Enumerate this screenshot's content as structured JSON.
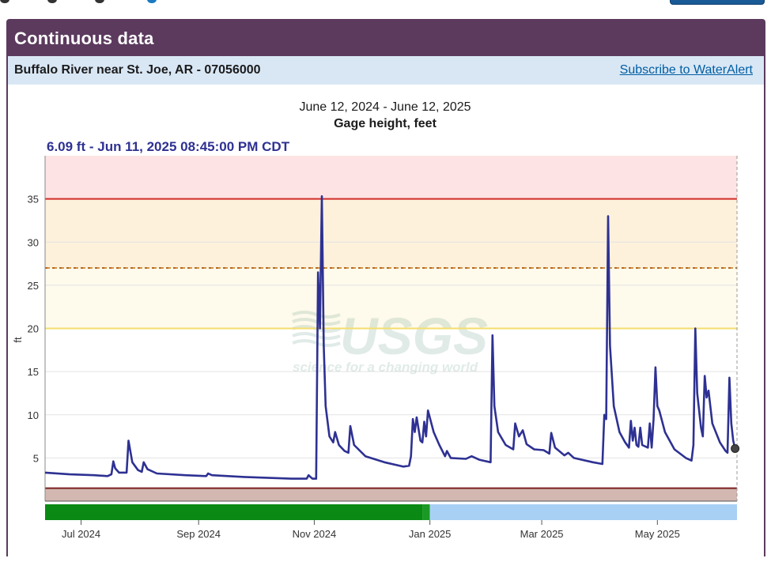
{
  "page": {
    "title": "Continuous data",
    "site_name": "Buffalo River near St. Joe, AR - 07056000",
    "subscribe_label": "Subscribe to WaterAlert"
  },
  "chart_data": {
    "type": "line",
    "date_range": "June 12, 2024 - June 12, 2025",
    "title": "Gage height, feet",
    "current_reading": "6.09 ft - Jun 11, 2025 08:45:00 PM CDT",
    "ylabel": "ft",
    "ylim": [
      0,
      40
    ],
    "yticks": [
      5,
      10,
      15,
      20,
      25,
      30,
      35
    ],
    "xlim": [
      "2024-06-12",
      "2025-06-12"
    ],
    "xticks": [
      {
        "date": "2024-07-01",
        "label": "Jul 2024"
      },
      {
        "date": "2024-09-01",
        "label": "Sep 2024"
      },
      {
        "date": "2024-11-01",
        "label": "Nov 2024"
      },
      {
        "date": "2025-01-01",
        "label": "Jan 2025"
      },
      {
        "date": "2025-03-01",
        "label": "Mar 2025"
      },
      {
        "date": "2025-05-01",
        "label": "May 2025"
      }
    ],
    "thresholds": [
      {
        "value": 35,
        "color": "#d22b2b",
        "style": "solid",
        "band_above": "#fde3e3"
      },
      {
        "value": 27,
        "color": "#b5651d",
        "style": "dashed",
        "band_above": "#fdf1dc"
      },
      {
        "value": 20,
        "color": "#f4de6b",
        "style": "solid",
        "band_above": "#fefaec"
      },
      {
        "value": 1.5,
        "color": "#7a1f1f",
        "style": "solid",
        "band_below": "#d3b8b2"
      }
    ],
    "grid": true,
    "watermark": {
      "mark": "USGS",
      "tagline": "science for a changing world"
    },
    "line_color": "#2e3192",
    "series": [
      {
        "points": [
          [
            "2024-06-12",
            3.3
          ],
          [
            "2024-06-25",
            3.1
          ],
          [
            "2024-07-08",
            3.0
          ],
          [
            "2024-07-15",
            2.9
          ],
          [
            "2024-07-17",
            3.1
          ],
          [
            "2024-07-18",
            4.6
          ],
          [
            "2024-07-19",
            3.8
          ],
          [
            "2024-07-21",
            3.3
          ],
          [
            "2024-07-25",
            3.3
          ],
          [
            "2024-07-26",
            7.0
          ],
          [
            "2024-07-28",
            4.5
          ],
          [
            "2024-07-31",
            3.6
          ],
          [
            "2024-08-02",
            3.4
          ],
          [
            "2024-08-03",
            4.5
          ],
          [
            "2024-08-05",
            3.7
          ],
          [
            "2024-08-10",
            3.2
          ],
          [
            "2024-08-25",
            3.0
          ],
          [
            "2024-09-05",
            2.9
          ],
          [
            "2024-09-06",
            3.2
          ],
          [
            "2024-09-08",
            3.0
          ],
          [
            "2024-09-25",
            2.8
          ],
          [
            "2024-10-20",
            2.6
          ],
          [
            "2024-10-28",
            2.6
          ],
          [
            "2024-10-29",
            3.0
          ],
          [
            "2024-10-31",
            2.6
          ],
          [
            "2024-11-02",
            2.6
          ],
          [
            "2024-11-03",
            26.5
          ],
          [
            "2024-11-04",
            20.0
          ],
          [
            "2024-11-05",
            35.3
          ],
          [
            "2024-11-06",
            18.0
          ],
          [
            "2024-11-07",
            11.0
          ],
          [
            "2024-11-09",
            7.5
          ],
          [
            "2024-11-11",
            6.8
          ],
          [
            "2024-11-12",
            8.0
          ],
          [
            "2024-11-14",
            6.5
          ],
          [
            "2024-11-17",
            5.8
          ],
          [
            "2024-11-19",
            5.6
          ],
          [
            "2024-11-20",
            8.7
          ],
          [
            "2024-11-22",
            6.5
          ],
          [
            "2024-11-28",
            5.2
          ],
          [
            "2024-12-08",
            4.5
          ],
          [
            "2024-12-18",
            4.0
          ],
          [
            "2024-12-21",
            4.1
          ],
          [
            "2024-12-22",
            5.2
          ],
          [
            "2024-12-23",
            9.5
          ],
          [
            "2024-12-24",
            8.0
          ],
          [
            "2024-12-25",
            9.7
          ],
          [
            "2024-12-27",
            7.0
          ],
          [
            "2024-12-28",
            6.8
          ],
          [
            "2024-12-29",
            9.2
          ],
          [
            "2024-12-30",
            7.5
          ],
          [
            "2024-12-31",
            10.5
          ],
          [
            "2025-01-03",
            8.0
          ],
          [
            "2025-01-06",
            6.5
          ],
          [
            "2025-01-09",
            5.2
          ],
          [
            "2025-01-10",
            5.8
          ],
          [
            "2025-01-12",
            5.0
          ],
          [
            "2025-01-20",
            4.9
          ],
          [
            "2025-01-23",
            5.2
          ],
          [
            "2025-01-27",
            4.8
          ],
          [
            "2025-02-02",
            4.5
          ],
          [
            "2025-02-03",
            19.2
          ],
          [
            "2025-02-04",
            11.0
          ],
          [
            "2025-02-06",
            8.0
          ],
          [
            "2025-02-10",
            6.5
          ],
          [
            "2025-02-14",
            6.0
          ],
          [
            "2025-02-15",
            9.0
          ],
          [
            "2025-02-17",
            7.5
          ],
          [
            "2025-02-19",
            8.2
          ],
          [
            "2025-02-21",
            6.6
          ],
          [
            "2025-02-25",
            6.0
          ],
          [
            "2025-03-02",
            5.9
          ],
          [
            "2025-03-05",
            5.5
          ],
          [
            "2025-03-06",
            7.9
          ],
          [
            "2025-03-08",
            6.2
          ],
          [
            "2025-03-13",
            5.3
          ],
          [
            "2025-03-15",
            5.6
          ],
          [
            "2025-03-18",
            5.0
          ],
          [
            "2025-03-28",
            4.5
          ],
          [
            "2025-04-02",
            4.3
          ],
          [
            "2025-04-03",
            10.0
          ],
          [
            "2025-04-04",
            9.5
          ],
          [
            "2025-04-05",
            33.0
          ],
          [
            "2025-04-06",
            18.0
          ],
          [
            "2025-04-08",
            11.0
          ],
          [
            "2025-04-11",
            8.0
          ],
          [
            "2025-04-14",
            6.8
          ],
          [
            "2025-04-16",
            6.2
          ],
          [
            "2025-04-17",
            9.3
          ],
          [
            "2025-04-18",
            7.0
          ],
          [
            "2025-04-19",
            8.5
          ],
          [
            "2025-04-20",
            6.5
          ],
          [
            "2025-04-21",
            6.3
          ],
          [
            "2025-04-22",
            8.5
          ],
          [
            "2025-04-23",
            6.5
          ],
          [
            "2025-04-26",
            6.2
          ],
          [
            "2025-04-27",
            9.0
          ],
          [
            "2025-04-28",
            6.2
          ],
          [
            "2025-04-29",
            9.5
          ],
          [
            "2025-04-30",
            15.5
          ],
          [
            "2025-05-01",
            11.0
          ],
          [
            "2025-05-02",
            10.5
          ],
          [
            "2025-05-05",
            8.0
          ],
          [
            "2025-05-10",
            6.0
          ],
          [
            "2025-05-16",
            5.0
          ],
          [
            "2025-05-19",
            4.7
          ],
          [
            "2025-05-20",
            6.5
          ],
          [
            "2025-05-21",
            20.0
          ],
          [
            "2025-05-22",
            12.5
          ],
          [
            "2025-05-24",
            8.5
          ],
          [
            "2025-05-25",
            7.5
          ],
          [
            "2025-05-26",
            14.5
          ],
          [
            "2025-05-27",
            12.0
          ],
          [
            "2025-05-28",
            12.8
          ],
          [
            "2025-05-30",
            9.0
          ],
          [
            "2025-06-03",
            6.8
          ],
          [
            "2025-06-06",
            5.8
          ],
          [
            "2025-06-07",
            5.6
          ],
          [
            "2025-06-08",
            14.3
          ],
          [
            "2025-06-09",
            9.0
          ],
          [
            "2025-06-10",
            7.0
          ],
          [
            "2025-06-11",
            6.09
          ]
        ]
      }
    ],
    "approval_bar": [
      {
        "from": "2024-06-12",
        "to": "2024-12-28",
        "color": "#0a8a14"
      },
      {
        "from": "2024-12-28",
        "to": "2025-01-01",
        "color": "#1a9a24"
      },
      {
        "from": "2025-01-01",
        "to": "2025-06-12",
        "color": "#a8d0f5"
      }
    ]
  }
}
